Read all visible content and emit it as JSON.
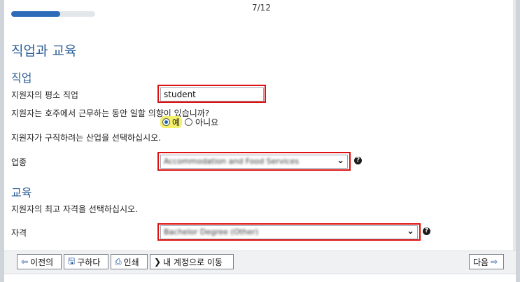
{
  "progress": {
    "step_text": "7/12",
    "fraction": 0.58
  },
  "page_title": "직업과 교육",
  "occupation_section": {
    "title": "직업",
    "usual_occupation_label": "지원자의 평소 직업",
    "usual_occupation_value": "student",
    "intend_to_work_label": "지원자는 호주에서 근무하는 동안 일할 의향이 있습니까?",
    "yes_label": "예",
    "no_label": "아니요",
    "industry_prompt": "지원자가 구직하려는 산업을 선택하십시오.",
    "industry_label": "업종",
    "industry_value": "Accommodation and Food Services"
  },
  "education_section": {
    "title": "교육",
    "prompt": "지원자의 최고 자격을 선택하십시오.",
    "qualification_label": "자격",
    "qualification_value": "Bachelor Degree (Other)"
  },
  "footer": {
    "previous_label": "이전의",
    "save_label": "구하다",
    "print_label": "인쇄",
    "go_to_account_label": "내 계정으로 이동",
    "next_label": "다음"
  },
  "colors": {
    "accent": "#2d6bb8",
    "highlight_border": "#e01010",
    "yes_highlight": "#f3f06a"
  }
}
